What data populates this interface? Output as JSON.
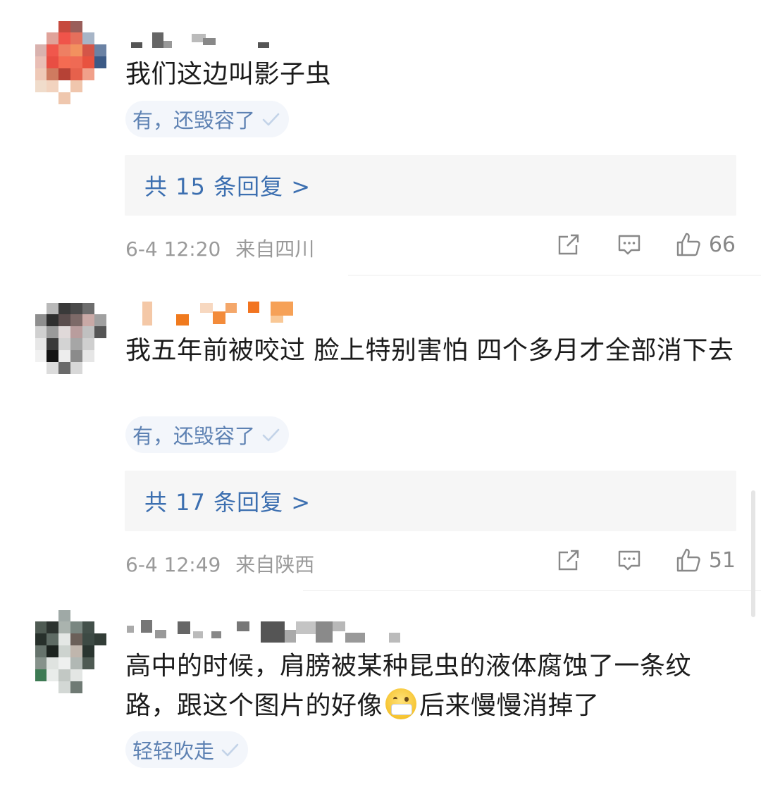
{
  "comments": [
    {
      "content": "我们这边叫影子虫",
      "tag": "有，还毁容了",
      "replies": "共 15 条回复 >",
      "time": "6-4 12:20",
      "location": "来自四川",
      "likes": "66"
    },
    {
      "content": "我五年前被咬过 脸上特别害怕 四个多月才全部消下去",
      "tag": "有，还毁容了",
      "replies": "共 17 条回复 >",
      "time": "6-4 12:49",
      "location": "来自陕西",
      "likes": "51"
    },
    {
      "content_before": "高中的时候，肩膀被某种昆虫的液体腐蚀了一条纹路，跟这个图片的好像",
      "content_after": "后来慢慢消掉了",
      "tag": "轻轻吹走"
    }
  ],
  "icons": {
    "share": "share-icon",
    "comment": "comment-icon",
    "like": "thumbs-up-icon",
    "check": "checkmark-icon",
    "emoji": "face-with-mask-emoji"
  },
  "colors": {
    "link_blue": "#3c6fb0",
    "tag_text": "#5e82b3",
    "meta_gray": "#9a9a9a"
  }
}
